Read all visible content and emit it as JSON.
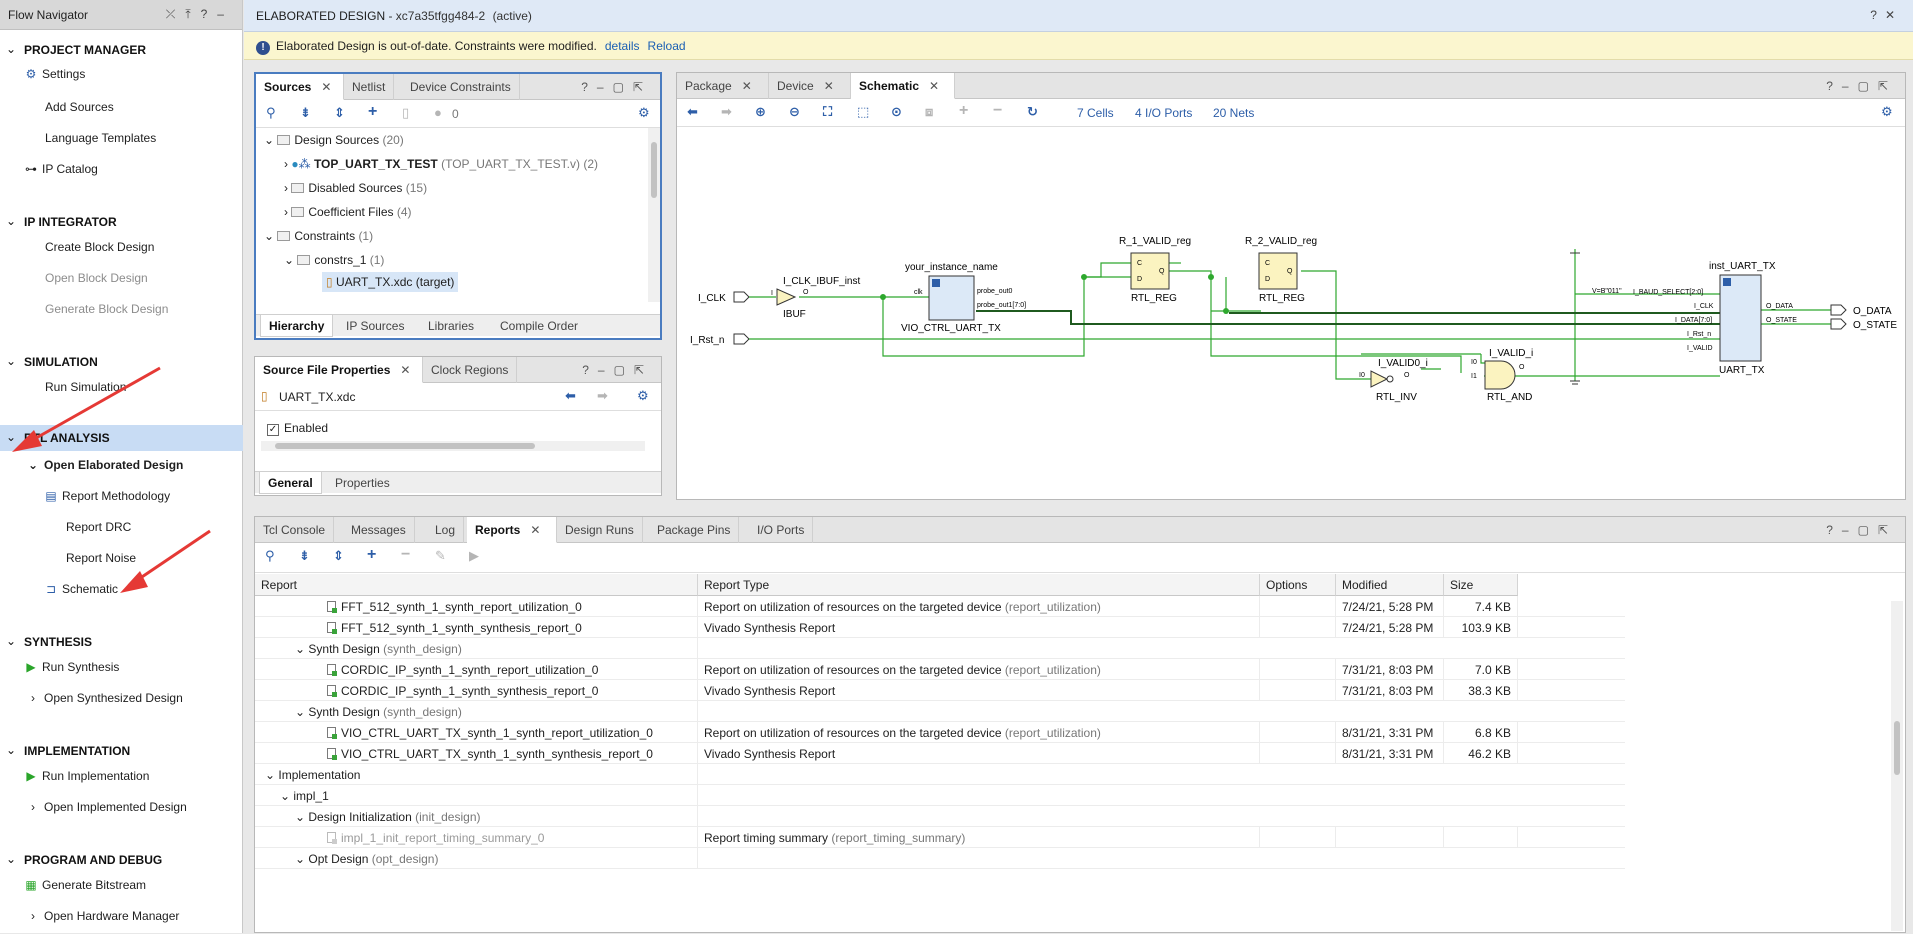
{
  "flow_navigator": {
    "title": "Flow Navigator",
    "sections": [
      {
        "label": "PROJECT MANAGER",
        "items": [
          "Settings",
          "Add Sources",
          "Language Templates",
          "IP Catalog"
        ]
      },
      {
        "label": "IP INTEGRATOR",
        "items": [
          "Create Block Design",
          "Open Block Design",
          "Generate Block Design"
        ]
      },
      {
        "label": "SIMULATION",
        "items": [
          "Run Simulation"
        ]
      },
      {
        "label": "RTL ANALYSIS",
        "items": [
          "Open Elaborated Design",
          "Report Methodology",
          "Report DRC",
          "Report Noise",
          "Schematic"
        ]
      },
      {
        "label": "SYNTHESIS",
        "items": [
          "Run Synthesis",
          "Open Synthesized Design"
        ]
      },
      {
        "label": "IMPLEMENTATION",
        "items": [
          "Run Implementation",
          "Open Implemented Design"
        ]
      },
      {
        "label": "PROGRAM AND DEBUG",
        "items": [
          "Generate Bitstream",
          "Open Hardware Manager"
        ]
      }
    ]
  },
  "header": {
    "title": "ELABORATED DESIGN",
    "subtitle": " - xc7a35tfgg484-2",
    "state": "(active)"
  },
  "banner": {
    "message": "Elaborated Design is out-of-date. Constraints were modified.",
    "details": "details",
    "reload": "Reload"
  },
  "sources": {
    "tabs": [
      "Sources",
      "Netlist",
      "Device Constraints"
    ],
    "count": "0",
    "rows": [
      {
        "text": "Design Sources",
        "extra": "(20)"
      },
      {
        "text": "TOP_UART_TX_TEST",
        "extra": "(TOP_UART_TX_TEST.v) (2)"
      },
      {
        "text": "Disabled Sources",
        "extra": "(15)"
      },
      {
        "text": "Coefficient Files",
        "extra": "(4)"
      },
      {
        "text": "Constraints",
        "extra": "(1)"
      },
      {
        "text": "constrs_1",
        "extra": "(1)"
      },
      {
        "text": "UART_TX.xdc",
        "extra": "(target)"
      }
    ],
    "bottom_tabs": [
      "Hierarchy",
      "IP Sources",
      "Libraries",
      "Compile Order"
    ]
  },
  "props": {
    "tabs": [
      "Source File Properties",
      "Clock Regions"
    ],
    "file": "UART_TX.xdc",
    "enabled": "Enabled",
    "bottom_tabs": [
      "General",
      "Properties"
    ]
  },
  "schematic": {
    "tabs": [
      "Package",
      "Device",
      "Schematic"
    ],
    "cells": "7 Cells",
    "ports": "4 I/O Ports",
    "nets": "20 Nets",
    "labels": {
      "i_clk": "I_CLK",
      "i_rst": "I_Rst_n",
      "ibuf_inst": "I_CLK_IBUF_inst",
      "ibuf": "IBUF",
      "ibuf_i": "I",
      "ibuf_o": "O",
      "vio_inst": "your_instance_name",
      "vio": "VIO_CTRL_UART_TX",
      "vio_clk": "clk",
      "probe0": "probe_out0",
      "probe1": "probe_out1[7:0]",
      "r1": "R_1_VALID_reg",
      "r2": "R_2_VALID_reg",
      "rtlreg": "RTL_REG",
      "pin_c": "C",
      "pin_d": "D",
      "pin_q": "Q",
      "inv_inst": "I_VALID0_i",
      "inv": "RTL_INV",
      "and_inst": "I_VALID_i",
      "and": "RTL_AND",
      "pin_i0": "I0",
      "pin_i1": "I1",
      "pin_o": "O",
      "uart_inst": "inst_UART_TX",
      "uart": "UART_TX",
      "const": "V=B\"011\"",
      "baud": "I_BAUD_SELECT[2:0]",
      "u_clk": "I_CLK",
      "u_data": "I_DATA[7:0]",
      "u_rst": "I_Rst_n",
      "u_valid": "I_VALID",
      "u_odata": "O_DATA",
      "u_ostate": "O_STATE",
      "o_data": "O_DATA",
      "o_state": "O_STATE"
    }
  },
  "reports": {
    "tabs": [
      "Tcl Console",
      "Messages",
      "Log",
      "Reports",
      "Design Runs",
      "Package Pins",
      "I/O Ports"
    ],
    "columns": [
      "Report",
      "Report Type",
      "Options",
      "Modified",
      "Size"
    ],
    "rows": [
      {
        "name": "FFT_512_synth_1_synth_report_utilization_0",
        "type": "Report on utilization of resources on the targeted device",
        "cmd": "(report_utilization)",
        "modified": "7/24/21, 5:28 PM",
        "size": "7.4 KB"
      },
      {
        "name": "FFT_512_synth_1_synth_synthesis_report_0",
        "type": "Vivado Synthesis Report",
        "cmd": "",
        "modified": "7/24/21, 5:28 PM",
        "size": "103.9 KB"
      },
      {
        "name": "Synth Design",
        "type": "",
        "cmd": "(synth_design)",
        "modified": "",
        "size": ""
      },
      {
        "name": "CORDIC_IP_synth_1_synth_report_utilization_0",
        "type": "Report on utilization of resources on the targeted device",
        "cmd": "(report_utilization)",
        "modified": "7/31/21, 8:03 PM",
        "size": "7.0 KB"
      },
      {
        "name": "CORDIC_IP_synth_1_synth_synthesis_report_0",
        "type": "Vivado Synthesis Report",
        "cmd": "",
        "modified": "7/31/21, 8:03 PM",
        "size": "38.3 KB"
      },
      {
        "name": "Synth Design",
        "type": "",
        "cmd": "(synth_design)",
        "modified": "",
        "size": ""
      },
      {
        "name": "VIO_CTRL_UART_TX_synth_1_synth_report_utilization_0",
        "type": "Report on utilization of resources on the targeted device",
        "cmd": "(report_utilization)",
        "modified": "8/31/21, 3:31 PM",
        "size": "6.8 KB"
      },
      {
        "name": "VIO_CTRL_UART_TX_synth_1_synth_synthesis_report_0",
        "type": "Vivado Synthesis Report",
        "cmd": "",
        "modified": "8/31/21, 3:31 PM",
        "size": "46.2 KB"
      },
      {
        "name": "Implementation",
        "type": "",
        "cmd": "",
        "modified": "",
        "size": ""
      },
      {
        "name": "impl_1",
        "type": "",
        "cmd": "",
        "modified": "",
        "size": ""
      },
      {
        "name": "Design Initialization",
        "type": "",
        "cmd": "(init_design)",
        "modified": "",
        "size": ""
      },
      {
        "name": "impl_1_init_report_timing_summary_0",
        "type": "Report timing summary",
        "cmd": "(report_timing_summary)",
        "modified": "",
        "size": ""
      },
      {
        "name": "Opt Design",
        "type": "",
        "cmd": "(opt_design)",
        "modified": "",
        "size": ""
      }
    ]
  },
  "colors": {
    "accent": "#2d5ea8",
    "selected": "#c8dcf4",
    "wire": "#2ea82e",
    "cell": "#fbf3c0",
    "banner": "#fbf6cf",
    "annotation": "#e53935"
  }
}
